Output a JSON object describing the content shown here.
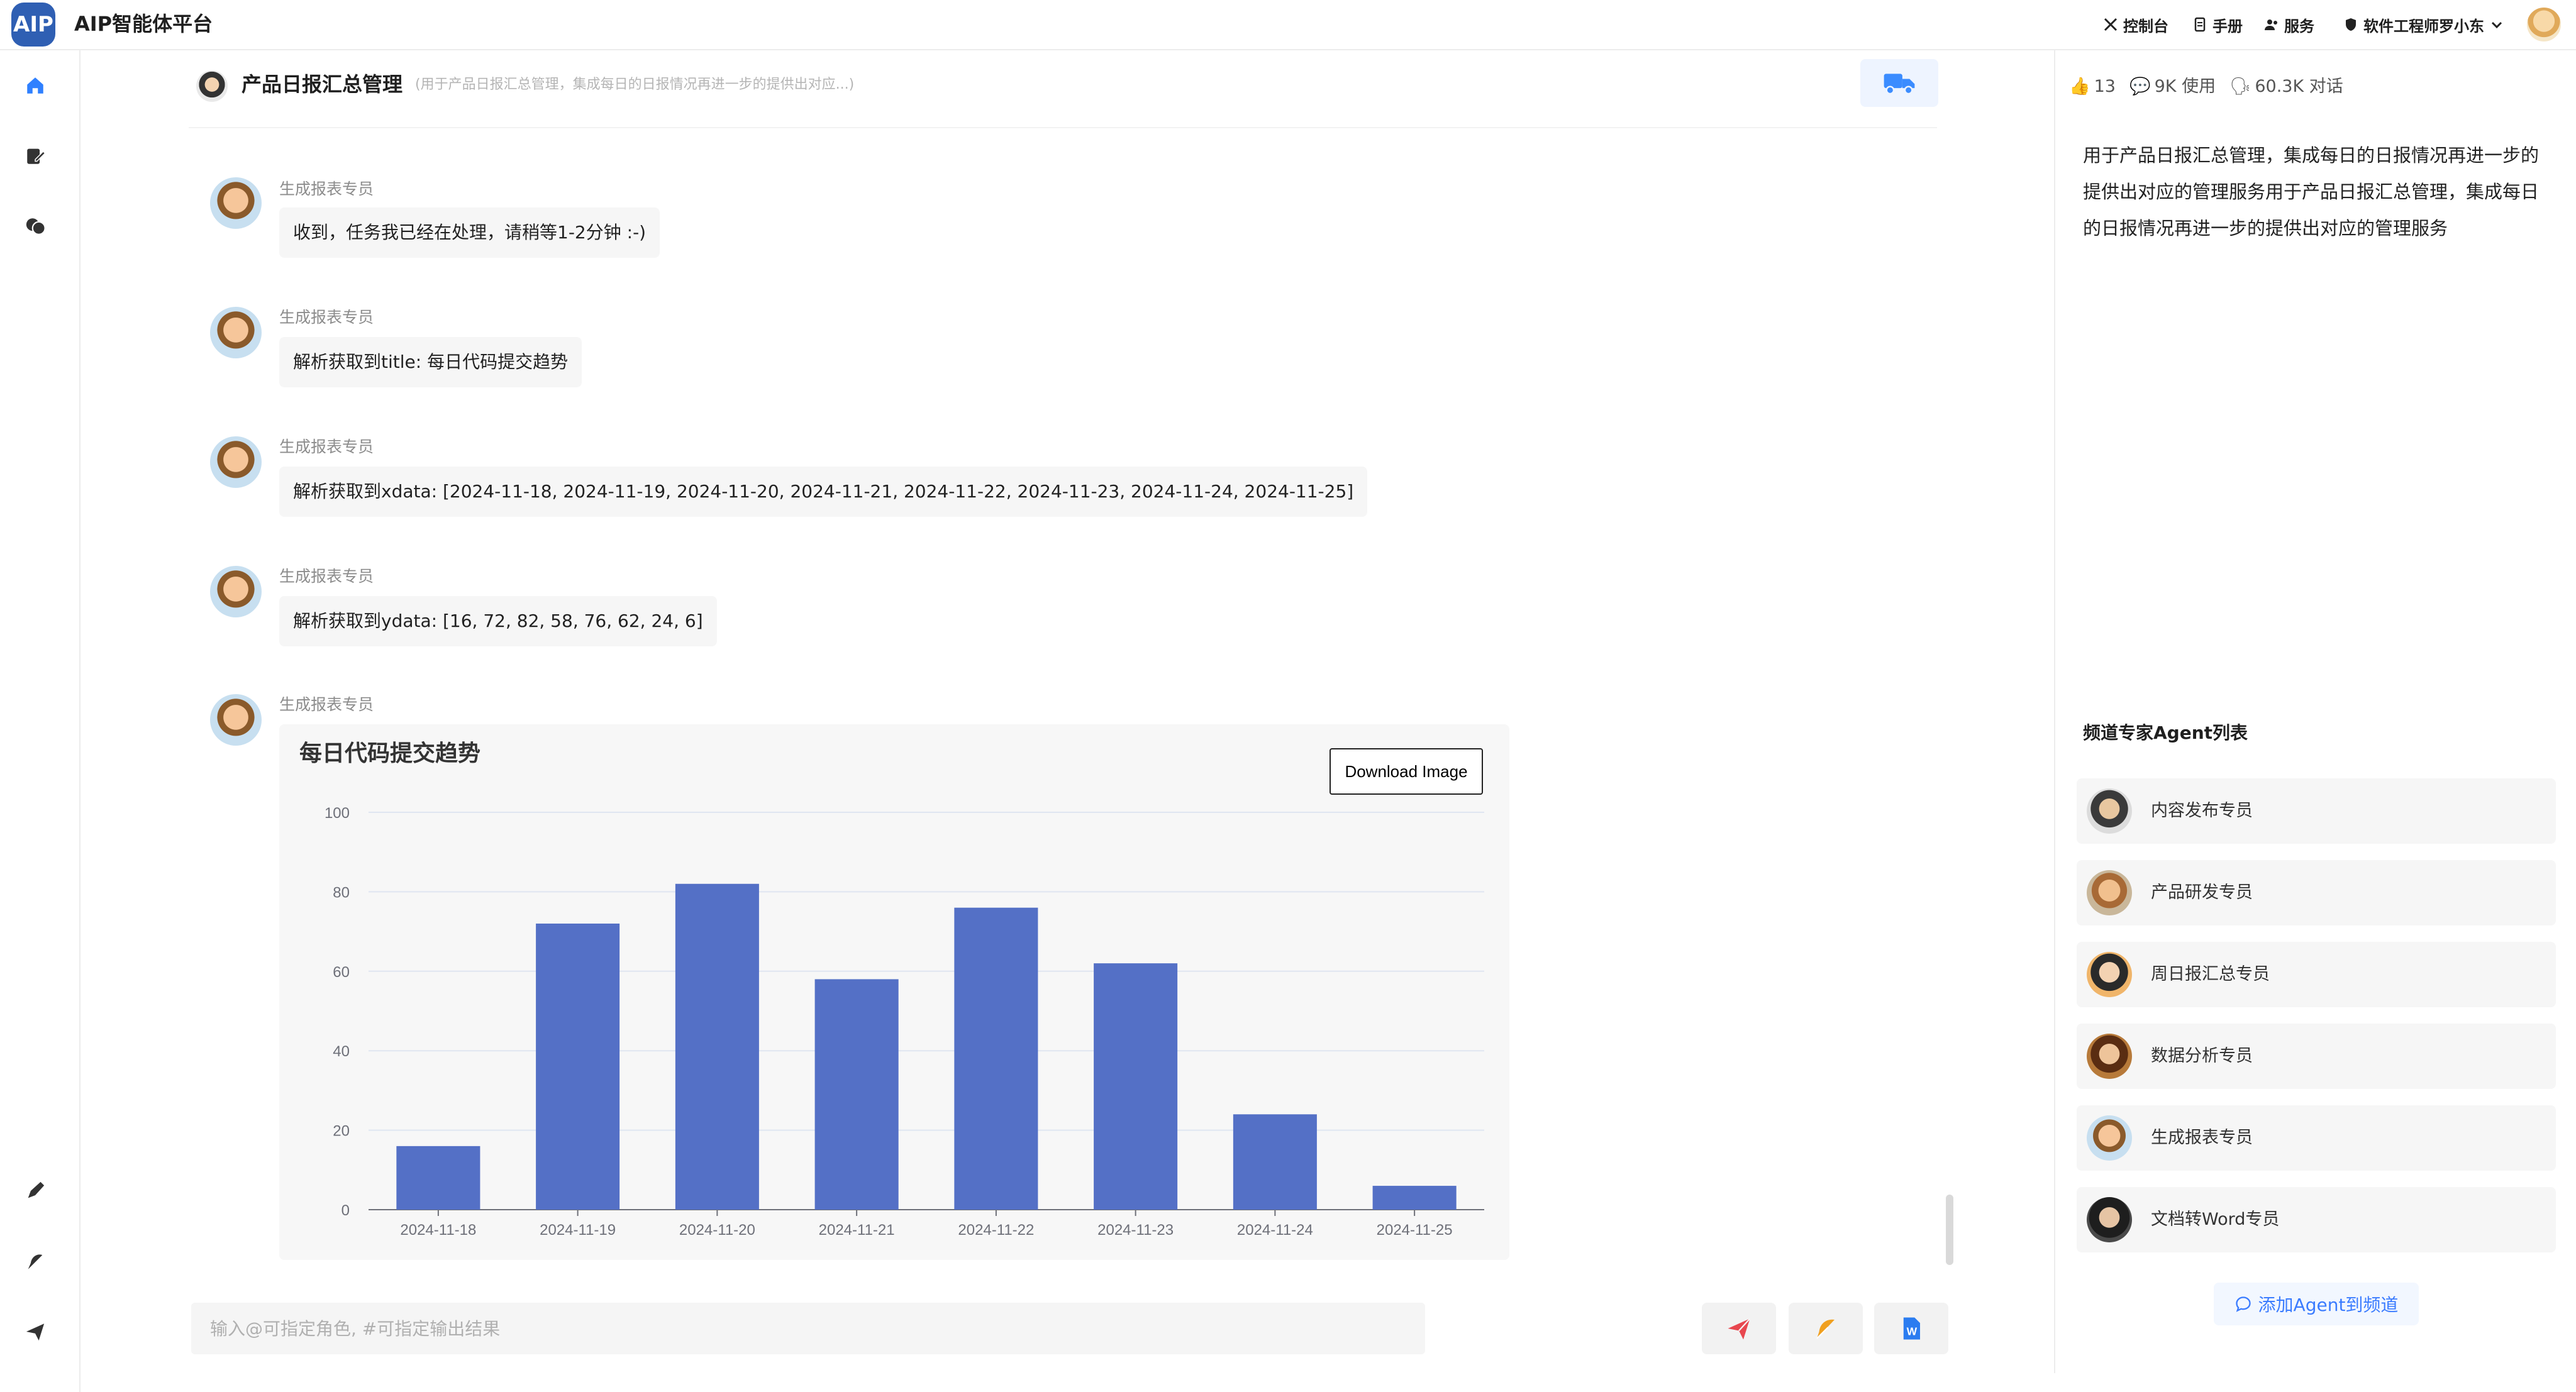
{
  "app": {
    "logo": "AIP",
    "title": "AIP智能体平台"
  },
  "topnav": {
    "console": "控制台",
    "manual": "手册",
    "service": "服务",
    "user": "软件工程师罗小东"
  },
  "channel": {
    "title": "产品日报汇总管理",
    "description": "(用于产品日报汇总管理，集成每日的日报情况再进一步的提供出对应...)"
  },
  "messages": [
    {
      "sender": "生成报表专员",
      "text": "收到，任务我已经在处理，请稍等1-2分钟 :-)"
    },
    {
      "sender": "生成报表专员",
      "text": "解析获取到title: 每日代码提交趋势"
    },
    {
      "sender": "生成报表专员",
      "text": "解析获取到xdata: [2024-11-18, 2024-11-19, 2024-11-20, 2024-11-21, 2024-11-22, 2024-11-23, 2024-11-24, 2024-11-25]"
    },
    {
      "sender": "生成报表专员",
      "text": "解析获取到ydata: [16, 72, 82, 58, 76, 62, 24, 6]"
    },
    {
      "sender": "生成报表专员",
      "text": ""
    }
  ],
  "chart": {
    "download_label": "Download Image"
  },
  "chart_data": {
    "type": "bar",
    "title": "每日代码提交趋势",
    "categories": [
      "2024-11-18",
      "2024-11-19",
      "2024-11-20",
      "2024-11-21",
      "2024-11-22",
      "2024-11-23",
      "2024-11-24",
      "2024-11-25"
    ],
    "values": [
      16,
      72,
      82,
      58,
      76,
      62,
      24,
      6
    ],
    "ylim": [
      0,
      100
    ],
    "yticks": [
      0,
      20,
      40,
      60,
      80,
      100
    ],
    "grid": true,
    "bar_color": "#5470c6"
  },
  "input": {
    "placeholder": "输入@可指定角色, #可指定输出结果"
  },
  "stats": {
    "likes": "13",
    "usage": "9K 使用",
    "chats": "60.3K 对话"
  },
  "channel_detail": "用于产品日报汇总管理，集成每日的日报情况再进一步的提供出对应的管理服务用于产品日报汇总管理，集成每日的日报情况再进一步的提供出对应的管理服务",
  "agents": {
    "title": "频道专家Agent列表",
    "items": [
      {
        "name": "内容发布专员"
      },
      {
        "name": "产品研发专员"
      },
      {
        "name": "周日报汇总专员"
      },
      {
        "name": "数据分析专员"
      },
      {
        "name": "生成报表专员"
      },
      {
        "name": "文档转Word专员"
      }
    ],
    "add_label": "添加Agent到频道"
  },
  "colors": {
    "accent": "#3b7cff",
    "bar": "#5470c6",
    "send": "#e8474f",
    "feather": "#f0a020",
    "word": "#2b7cf0"
  }
}
